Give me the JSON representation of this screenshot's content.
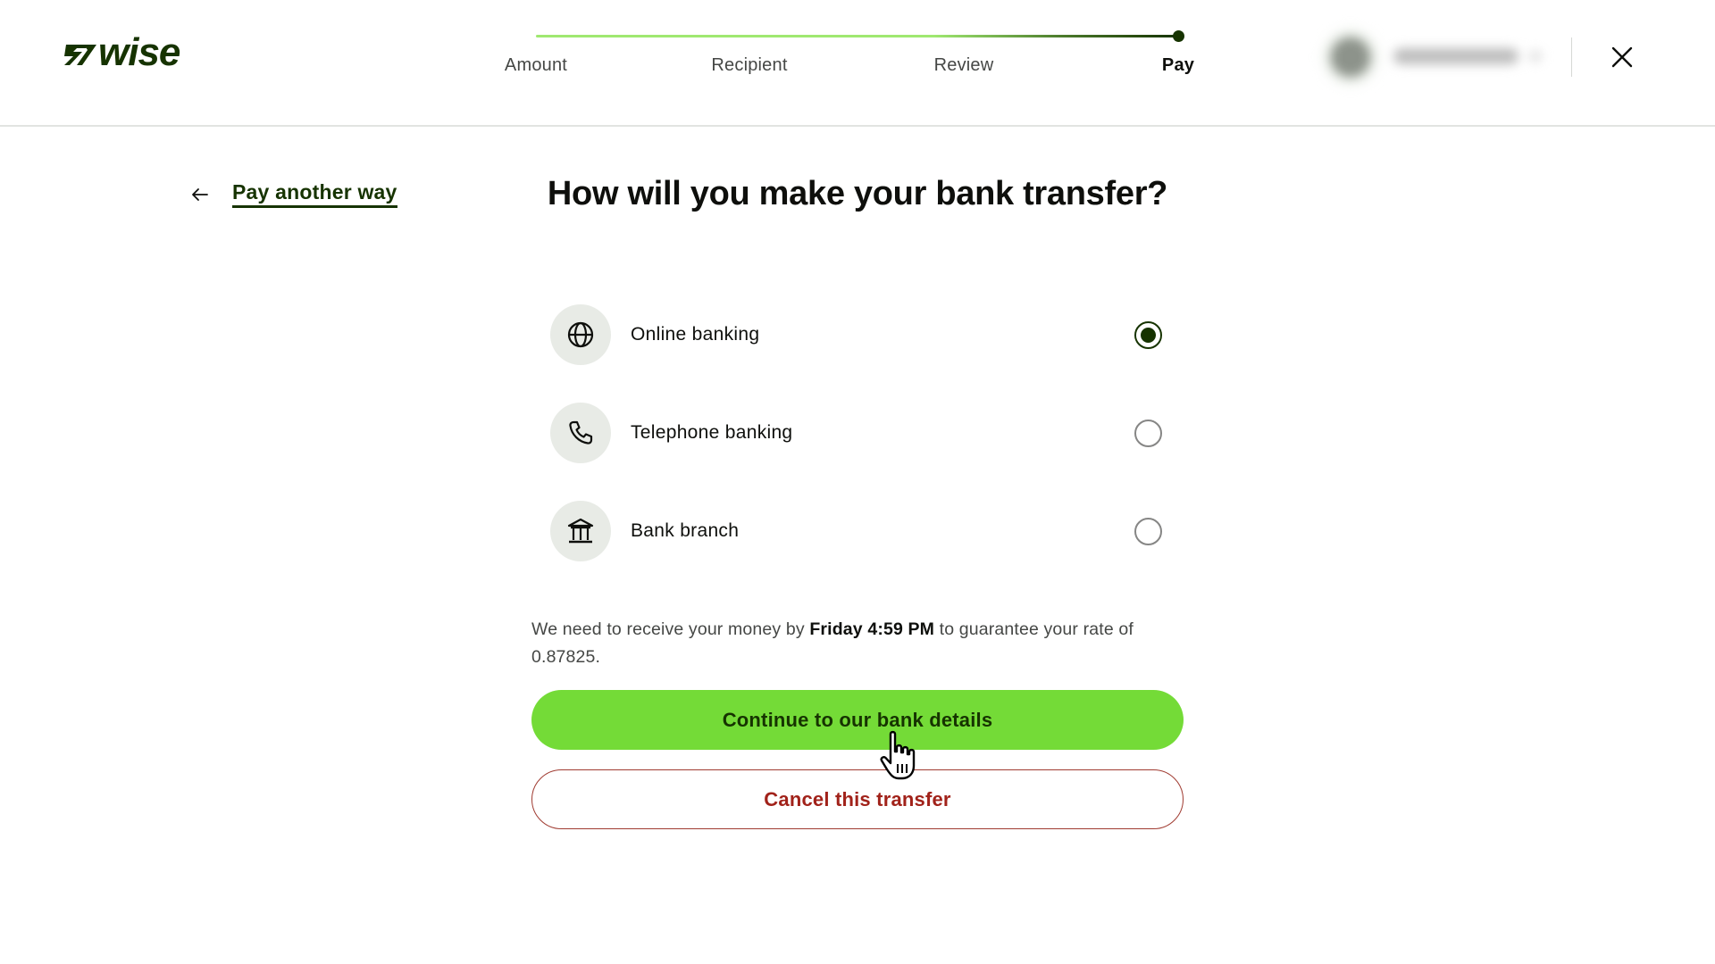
{
  "brand": {
    "logo_text": "wise",
    "primary_color": "#163300",
    "accent_color": "#9fe870",
    "button_color": "#74db37",
    "danger_color": "#a1221a"
  },
  "header": {
    "steps": [
      {
        "label": "Amount",
        "state": "complete"
      },
      {
        "label": "Recipient",
        "state": "complete"
      },
      {
        "label": "Review",
        "state": "complete"
      },
      {
        "label": "Pay",
        "state": "current"
      }
    ],
    "progress_step": 4,
    "progress_total": 4,
    "profile": {
      "name": "(blurred)",
      "avatar_icon": "avatar-icon",
      "chevron_icon": "chevron-down-icon"
    },
    "close_icon": "close-icon"
  },
  "back_link": {
    "icon": "arrow-left-icon",
    "label": "Pay another way"
  },
  "main": {
    "title": "How will you make your bank transfer?",
    "options": [
      {
        "label": "Online banking",
        "icon": "globe-icon",
        "selected": true
      },
      {
        "label": "Telephone banking",
        "icon": "phone-icon",
        "selected": false
      },
      {
        "label": "Bank branch",
        "icon": "bank-icon",
        "selected": false
      }
    ],
    "note": {
      "prefix": "We need to receive your money by ",
      "deadline": "Friday 4:59 PM",
      "suffix": " to guarantee your rate of 0.87825.",
      "rate": "0.87825"
    },
    "primary_button": "Continue to our bank details",
    "secondary_button": "Cancel this transfer"
  },
  "cursor": {
    "type": "hand-pointer",
    "icon": "hand-cursor-icon"
  }
}
